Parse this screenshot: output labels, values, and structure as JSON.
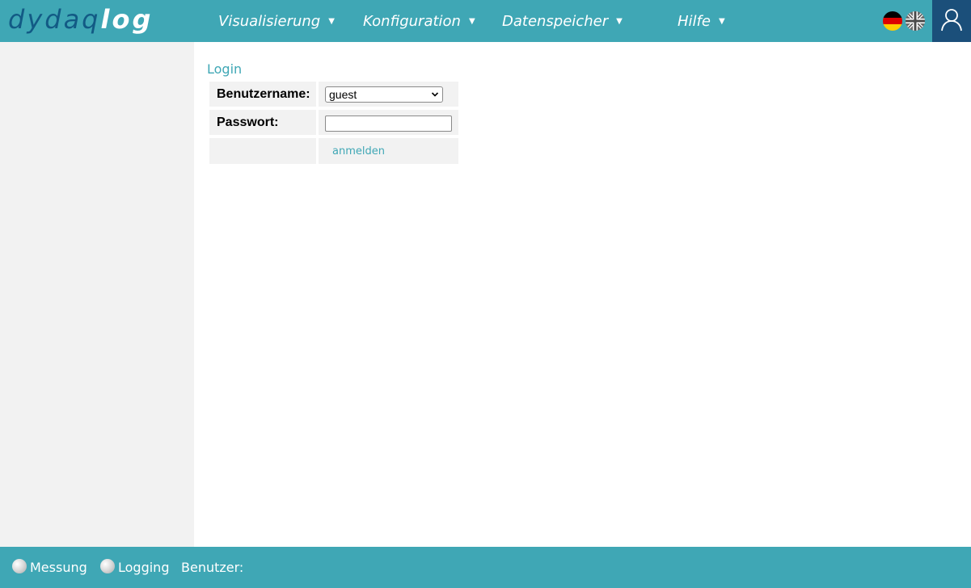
{
  "header": {
    "logo": {
      "light": "dydaq",
      "bold": "log"
    },
    "nav": [
      {
        "label": "Visualisierung"
      },
      {
        "label": "Konfiguration"
      },
      {
        "label": "Datenspeicher"
      },
      {
        "label": "Hilfe"
      }
    ],
    "nav_arrow": "▼",
    "languages": [
      "german-flag-icon",
      "uk-flag-icon"
    ],
    "user_icon": "user-icon"
  },
  "login": {
    "title": "Login",
    "username_label": "Benutzername:",
    "username_value": "guest",
    "password_label": "Passwort:",
    "password_value": "",
    "submit_label": "anmelden"
  },
  "footer": {
    "measurement_label": "Messung",
    "logging_label": "Logging",
    "user_label": "Benutzer:",
    "user_value": ""
  },
  "colors": {
    "accent": "#3fa7b5",
    "user_box": "#1b4f7a",
    "logo_dark": "#125a85",
    "panel": "#f2f2f2"
  }
}
